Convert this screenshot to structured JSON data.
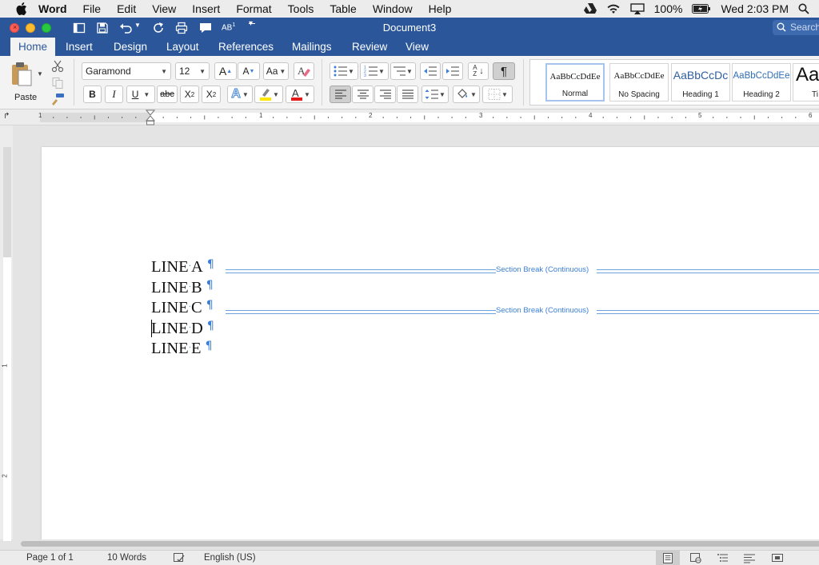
{
  "menubar": {
    "app": "Word",
    "items": [
      "File",
      "Edit",
      "View",
      "Insert",
      "Format",
      "Tools",
      "Table",
      "Window",
      "Help"
    ],
    "battery": "100%",
    "clock": "Wed 2:03 PM"
  },
  "titlebar": {
    "title": "Document3",
    "search_placeholder": "Search"
  },
  "tabs": [
    "Home",
    "Insert",
    "Design",
    "Layout",
    "References",
    "Mailings",
    "Review",
    "View"
  ],
  "ribbon": {
    "paste_label": "Paste",
    "font_name": "Garamond",
    "font_size": "12",
    "bold": "B",
    "italic": "I",
    "underline": "U",
    "strike": "abc",
    "subscript": "X",
    "superscript": "X",
    "sub_mark": "2",
    "sup_mark": "2",
    "grow_font": "A",
    "shrink_font": "A",
    "change_case": "Aa",
    "sort": "A Z",
    "pilcrow": "¶",
    "styles": [
      {
        "sample": "AaBbCcDdEe",
        "name": "Normal"
      },
      {
        "sample": "AaBbCcDdEe",
        "name": "No Spacing"
      },
      {
        "sample": "AaBbCcDc",
        "name": "Heading 1"
      },
      {
        "sample": "AaBbCcDdEe",
        "name": "Heading 2"
      },
      {
        "sample": "AaB",
        "name": "Ti"
      }
    ]
  },
  "ruler": {
    "numbers": [
      "1",
      "1",
      "2",
      "3",
      "4",
      "5",
      "6"
    ]
  },
  "vruler": {
    "numbers": [
      "1",
      "2"
    ]
  },
  "document": {
    "lines": [
      {
        "word": "LINE",
        "letter": "A"
      },
      {
        "word": "LINE",
        "letter": "B"
      },
      {
        "word": "LINE",
        "letter": "C"
      },
      {
        "word": "LINE",
        "letter": "D"
      },
      {
        "word": "LINE",
        "letter": "E"
      }
    ],
    "middot": "·",
    "pilcrow": "¶",
    "section_break_label": "Section Break (Continuous)"
  },
  "status": {
    "page": "Page 1 of 1",
    "words": "10 Words",
    "language": "English (US)"
  },
  "colors": {
    "title_blue": "#2b579a",
    "format_mark_blue": "#3c7fd6"
  }
}
